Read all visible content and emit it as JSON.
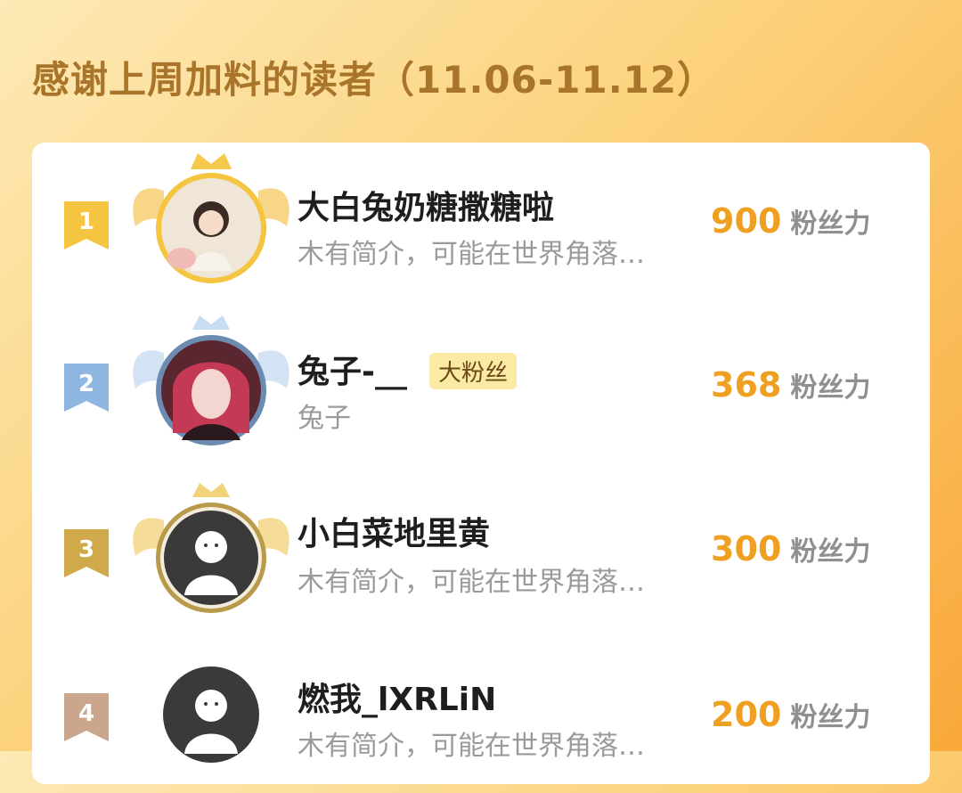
{
  "header": {
    "title": "感谢上周加料的读者（11.06-11.12）"
  },
  "readers": [
    {
      "rank": "1",
      "name": "大白兔奶糖撒糖啦",
      "bio": "木有简介，可能在世界角落…",
      "score": "900",
      "unit": "粉丝力",
      "badge": ""
    },
    {
      "rank": "2",
      "name": "兔子-__",
      "bio": "兔子",
      "score": "368",
      "unit": "粉丝力",
      "badge": "大粉丝"
    },
    {
      "rank": "3",
      "name": "小白菜地里黄",
      "bio": "木有简介，可能在世界角落…",
      "score": "300",
      "unit": "粉丝力",
      "badge": ""
    },
    {
      "rank": "4",
      "name": "燃我_lXRLiN",
      "bio": "木有简介，可能在世界角落…",
      "score": "200",
      "unit": "粉丝力",
      "badge": ""
    }
  ],
  "colors": {
    "accent": "#f0a020",
    "rank1": "#f5c440",
    "rank2": "#8fb6e0",
    "rank3": "#cfa94a",
    "rank4": "#c9a68c"
  },
  "icons": {
    "rank_ribbon": "ribbon-icon",
    "crown": "crown-icon",
    "wings": "wings-icon",
    "default_avatar": "ghost-avatar-icon"
  }
}
